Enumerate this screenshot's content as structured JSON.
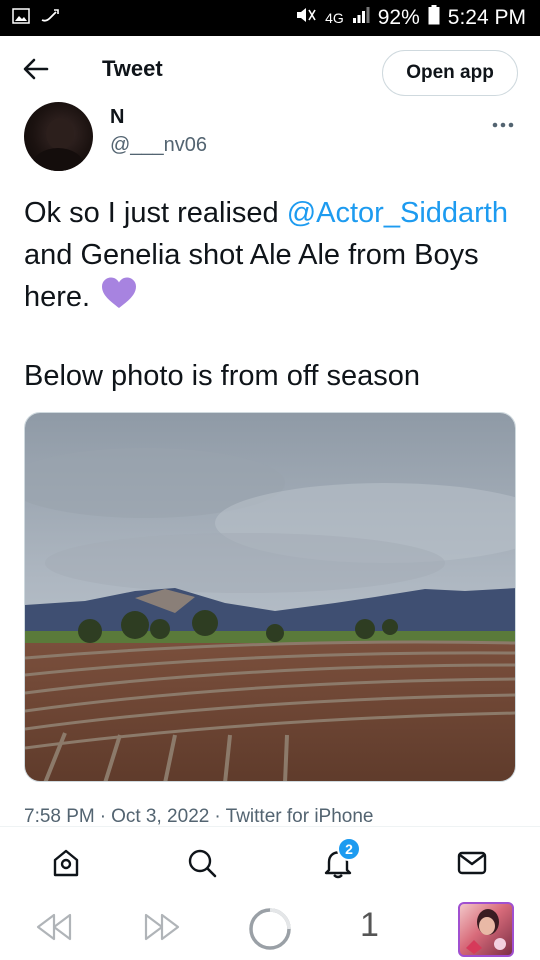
{
  "status_bar": {
    "network": "4G",
    "battery": "92%",
    "time": "5:24 PM"
  },
  "header": {
    "title": "Tweet",
    "open_app_label": "Open app"
  },
  "author": {
    "name": "N",
    "handle": "@___nv06"
  },
  "tweet": {
    "text_before": "Ok so I just realised ",
    "mention": "@Actor_Siddarth",
    "text_after": " and Genelia shot Ale Ale from Boys here.",
    "line2": "Below photo is from off season"
  },
  "meta": {
    "time": "7:58 PM",
    "date": "Oct 3, 2022",
    "source": "Twitter for iPhone",
    "separator": "·"
  },
  "tabbar": {
    "notifications_badge": "2"
  },
  "browser": {
    "tab_count": "1"
  },
  "colors": {
    "accent": "#1d9bf0",
    "heart": "#a783e0"
  },
  "icons": [
    "back-arrow-icon",
    "more-icon",
    "purple-heart-icon",
    "home-icon",
    "search-icon",
    "notifications-bell-icon",
    "messages-icon",
    "browser-back-icon",
    "browser-forward-icon",
    "loading-icon"
  ]
}
